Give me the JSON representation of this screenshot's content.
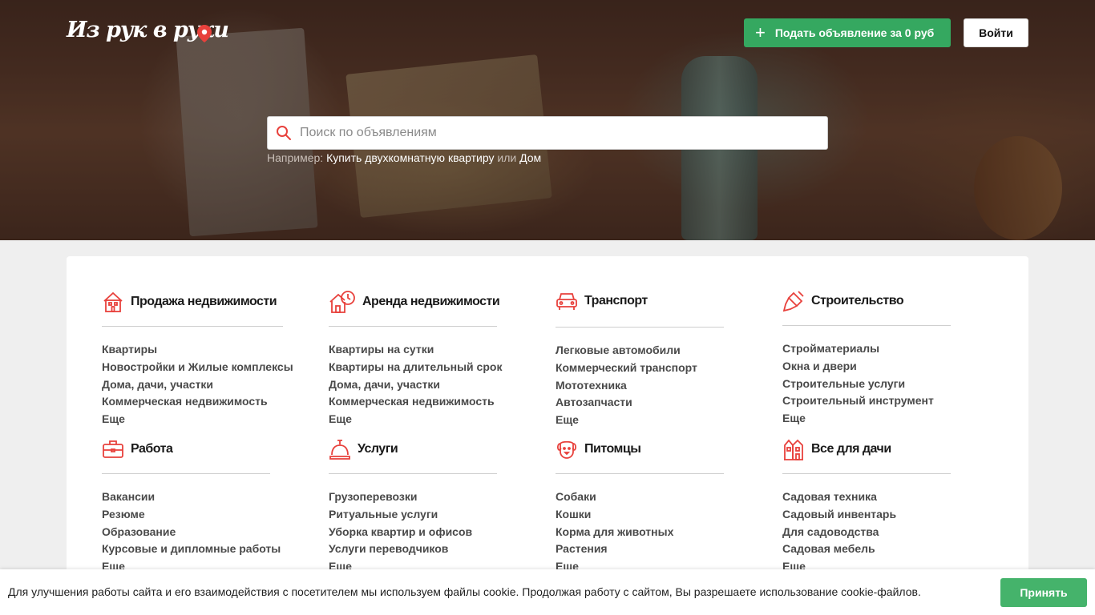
{
  "header": {
    "logo_text": "Из рук в руки",
    "post_button_label": "Подать объявление за 0 руб",
    "login_button_label": "Войти"
  },
  "search": {
    "placeholder": "Поиск по объявлениям",
    "example_prefix": "Например:",
    "example_link_1": "Купить двухкомнатную квартиру",
    "example_or": "или",
    "example_link_2": "Дом"
  },
  "categories": [
    {
      "icon": "house-icon",
      "title": "Продажа недвижимости",
      "items": [
        "Квартиры",
        "Новостройки и Жилые комплексы",
        "Дома, дачи, участки",
        "Коммерческая недвижимость",
        "Еще"
      ]
    },
    {
      "icon": "rent-house-icon",
      "title": "Аренда недвижимости",
      "items": [
        "Квартиры на сутки",
        "Квартиры на длительный срок",
        "Дома, дачи, участки",
        "Коммерческая недвижимость",
        "Еще"
      ]
    },
    {
      "icon": "car-icon",
      "title": "Транспорт",
      "items": [
        "Легковые автомобили",
        "Коммерческий транспорт",
        "Мототехника",
        "Автозапчасти",
        "Еще"
      ]
    },
    {
      "icon": "paintbrush-icon",
      "title": "Строительство",
      "items": [
        "Стройматериалы",
        "Окна и двери",
        "Строительные услуги",
        "Строительный инструмент",
        "Еще"
      ]
    },
    {
      "icon": "briefcase-icon",
      "title": "Работа",
      "items": [
        "Вакансии",
        "Резюме",
        "Образование",
        "Курсовые и дипломные работы",
        "Еще"
      ]
    },
    {
      "icon": "bell-service-icon",
      "title": "Услуги",
      "items": [
        "Грузоперевозки",
        "Ритуальные услуги",
        "Уборка квартир и офисов",
        "Услуги переводчиков",
        "Еще"
      ]
    },
    {
      "icon": "dog-icon",
      "title": "Питомцы",
      "items": [
        "Собаки",
        "Кошки",
        "Корма для животных",
        "Растения",
        "Еще"
      ]
    },
    {
      "icon": "country-house-icon",
      "title": "Все для дачи",
      "items": [
        "Садовая техника",
        "Садовый инвентарь",
        "Для садоводства",
        "Садовая мебель",
        "Еще"
      ]
    }
  ],
  "cookie": {
    "text": "Для улучшения работы сайта и его взаимодействия с посетителем мы используем файлы cookie. Продолжая работу с сайтом, Вы разрешаете использование cookie-файлов.",
    "accept_label": "Принять"
  },
  "colors": {
    "accent_red": "#e8413c",
    "green": "#35a860"
  }
}
